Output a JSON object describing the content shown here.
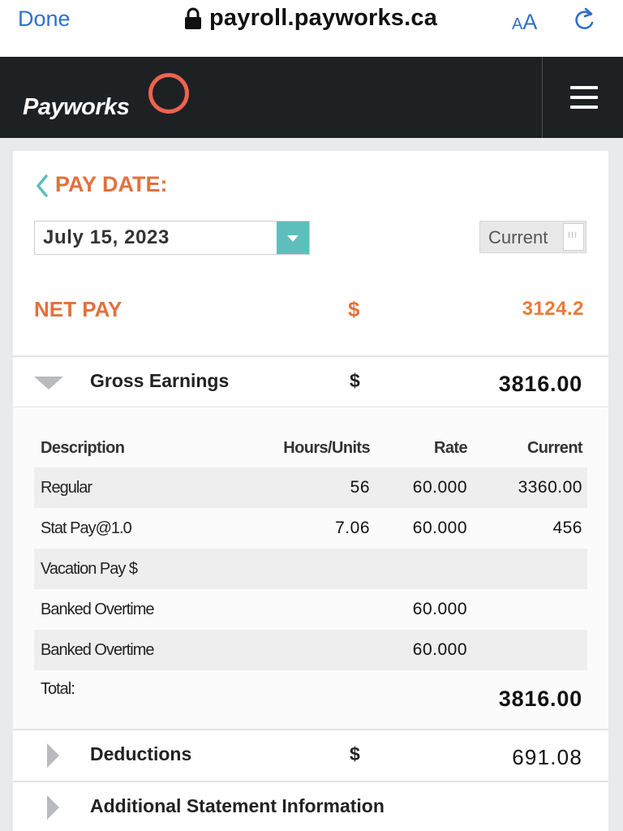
{
  "browser": {
    "done_label": "Done",
    "url": "payroll.payworks.ca",
    "text_size_small": "A",
    "text_size_large": "A"
  },
  "header": {
    "logo_text": "Payworks",
    "brand_color": "#f0624f"
  },
  "pay_date": {
    "label": "PAY DATE:",
    "selected": "July 15, 2023",
    "toggle_label": "Current"
  },
  "net_pay": {
    "label": "NET PAY",
    "currency": "$",
    "value": "3124.2"
  },
  "gross_earnings": {
    "title": "Gross Earnings",
    "currency": "$",
    "total": "3816.00",
    "columns": [
      "Description",
      "Hours/Units",
      "Rate",
      "Current"
    ],
    "rows": [
      {
        "description": "Regular",
        "hours": "56",
        "rate": "60.000",
        "current": "3360.00"
      },
      {
        "description": "Stat Pay@1.0",
        "hours": "7.06",
        "rate": "60.000",
        "current": "456"
      },
      {
        "description": "Vacation Pay $",
        "hours": "",
        "rate": "",
        "current": ""
      },
      {
        "description": "Banked Overtime",
        "hours": "",
        "rate": "60.000",
        "current": ""
      },
      {
        "description": "Banked Overtime",
        "hours": "",
        "rate": "60.000",
        "current": ""
      }
    ],
    "total_label": "Total:",
    "total_value": "3816.00"
  },
  "deductions": {
    "title": "Deductions",
    "currency": "$",
    "total": "691.08"
  },
  "additional": {
    "title": "Additional Statement Information"
  },
  "colors": {
    "accent_orange": "#e2713e",
    "teal": "#5dbfbc",
    "header_bg": "#1d2124",
    "link_blue": "#2f6fd0"
  }
}
